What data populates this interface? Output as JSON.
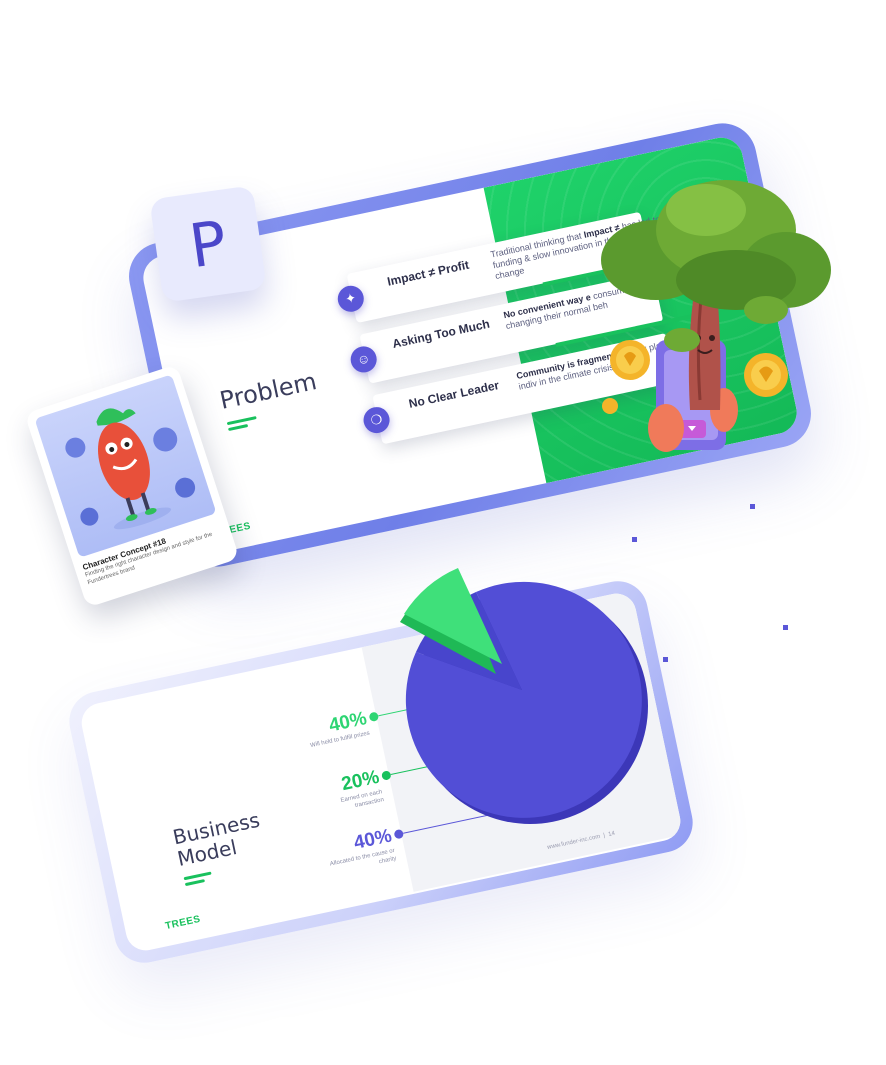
{
  "badge": {
    "letter": "P"
  },
  "problem_slide": {
    "title": "Problem",
    "logo": "TREES",
    "rows": [
      {
        "title": "Impact ≠ Profit",
        "icon": "lightbulb-icon",
        "desc_lead": "Traditional thinking that ",
        "desc_bold": "Impact ≠",
        "desc_rest": " has led to less funding & slow innovation in the fight against change"
      },
      {
        "title": "Asking Too Much",
        "icon": "user-icon",
        "desc_bold": "No convenient way e",
        "desc_rest": " consumers to make a differ changing their normal beh"
      },
      {
        "title": "No Clear Leader",
        "icon": "chat-bubbles-icon",
        "desc_bold": "Community is fragmented",
        "desc_rest": " clear platform is for indiv in the climate crisis"
      }
    ]
  },
  "character_card": {
    "title": "Character Concept #18",
    "desc": "Finding the right character design and style for the Fundertrees brand"
  },
  "business_slide": {
    "title": "Business Model",
    "logo": "TREES",
    "stats": [
      {
        "pct": "40%",
        "caption": "Will held to fulfill prizes",
        "color": "#2ed573"
      },
      {
        "pct": "20%",
        "caption": "Earned on each transaction",
        "color": "#19c15d"
      },
      {
        "pct": "40%",
        "caption": "Allocated to the cause or charity",
        "color": "#5b57d8"
      }
    ],
    "footer_url": "www.funder-inc.com",
    "page_number": "14"
  },
  "colors": {
    "brand_purple": "#5b57d8",
    "brand_green": "#19c15d",
    "frame_blue": "#7c8aee"
  }
}
